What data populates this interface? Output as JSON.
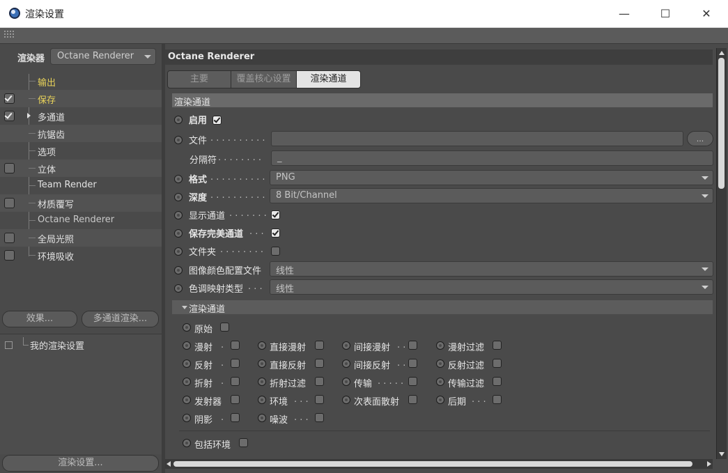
{
  "window": {
    "title": "渲染设置",
    "minimize_glyph": "—",
    "maximize_glyph": "☐",
    "close_glyph": "✕"
  },
  "left": {
    "renderer_label": "渲染器",
    "renderer_value": "Octane Renderer",
    "tree": [
      {
        "label": "输出",
        "checkbox": false,
        "checked": false,
        "color": "yellow"
      },
      {
        "label": "保存",
        "checkbox": true,
        "checked": true,
        "color": "yellow"
      },
      {
        "label": "多通道",
        "checkbox": true,
        "checked": true,
        "color": "white",
        "expander": true
      },
      {
        "label": "抗锯齿",
        "checkbox": false,
        "checked": false,
        "color": "white"
      },
      {
        "label": "选项",
        "checkbox": false,
        "checked": false,
        "color": "white"
      },
      {
        "label": "立体",
        "checkbox": true,
        "checked": false,
        "color": "white"
      },
      {
        "label": "Team Render",
        "checkbox": false,
        "checked": false,
        "color": "white"
      },
      {
        "label": "材质覆写",
        "checkbox": true,
        "checked": false,
        "color": "white"
      },
      {
        "label": "Octane Renderer",
        "checkbox": false,
        "checked": false,
        "color": "grey"
      },
      {
        "label": "全局光照",
        "checkbox": true,
        "checked": false,
        "color": "white"
      },
      {
        "label": "环境吸收",
        "checkbox": true,
        "checked": false,
        "color": "white"
      }
    ],
    "effects_button": "效果...",
    "multipass_button": "多通道渲染...",
    "preset_label": "我的渲染设置",
    "render_settings_button": "渲染设置..."
  },
  "right": {
    "header": "Octane Renderer",
    "tabs": [
      "主要",
      "覆盖核心设置",
      "渲染通道"
    ],
    "active_tab": 2,
    "section_title": "渲染通道",
    "enable_label": "启用",
    "enable_checked": true,
    "file_label": "文件",
    "file_value": "",
    "browse_label": "...",
    "separator_label": "分隔符",
    "separator_value": "_",
    "format_label": "格式",
    "format_value": "PNG",
    "depth_label": "深度",
    "depth_value": "8 Bit/Channel",
    "show_passes_label": "显示通道",
    "show_passes_checked": true,
    "save_beauty_label": "保存完美通道",
    "save_beauty_checked": true,
    "folder_label": "文件夹",
    "folder_checked": false,
    "color_profile_label": "图像颜色配置文件",
    "color_profile_value": "线性",
    "tonemap_label": "色调映射类型",
    "tonemap_value": "线性",
    "passes_group_title": "渲染通道",
    "raw_label": "原始",
    "passes": [
      [
        "漫射",
        "直接漫射",
        "间接漫射",
        "漫射过滤"
      ],
      [
        "反射",
        "直接反射",
        "间接反射",
        "反射过滤"
      ],
      [
        "折射",
        "折射过滤",
        "传输",
        "传输过滤"
      ],
      [
        "发射器",
        "环境",
        "次表面散射",
        "后期"
      ],
      [
        "阴影",
        "噪波"
      ]
    ],
    "include_env_label": "包括环境"
  }
}
